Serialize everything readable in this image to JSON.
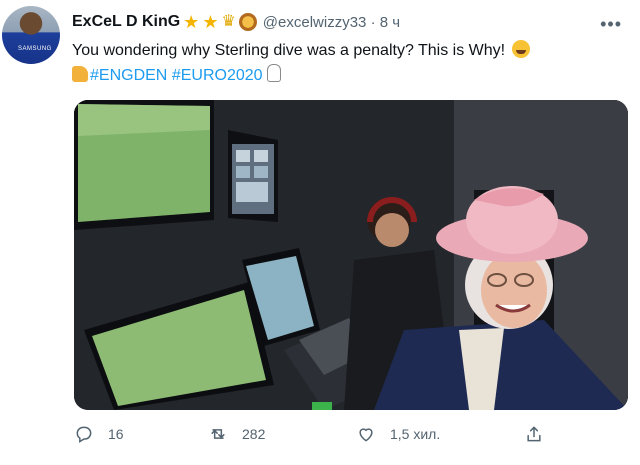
{
  "tweet": {
    "author_name": "ExCeL D KinG",
    "avatar_jersey": "SAMSUNG",
    "handle": "@excelwizzy33",
    "separator": "·",
    "time": "8 ч",
    "text_main": "You wondering why Sterling dive was a penalty? This is Why!",
    "hashtags": [
      "#ENGDEN",
      "#EURO2020"
    ],
    "icons": [
      "star-icon",
      "star-icon",
      "crown-icon",
      "lion-icon",
      "laughing-emoji",
      "thumbs-up-emoji",
      "sticker-icon"
    ]
  },
  "media": {
    "description_icons": [
      "var-room-monitors",
      "queen-with-pink-hat"
    ]
  },
  "actions": {
    "replies": "16",
    "retweets": "282",
    "likes": "1,5 хил."
  },
  "colors": {
    "accent": "#1d9bf0",
    "text": "#0f1419",
    "secondary": "#536471",
    "star": "#f4b400"
  }
}
